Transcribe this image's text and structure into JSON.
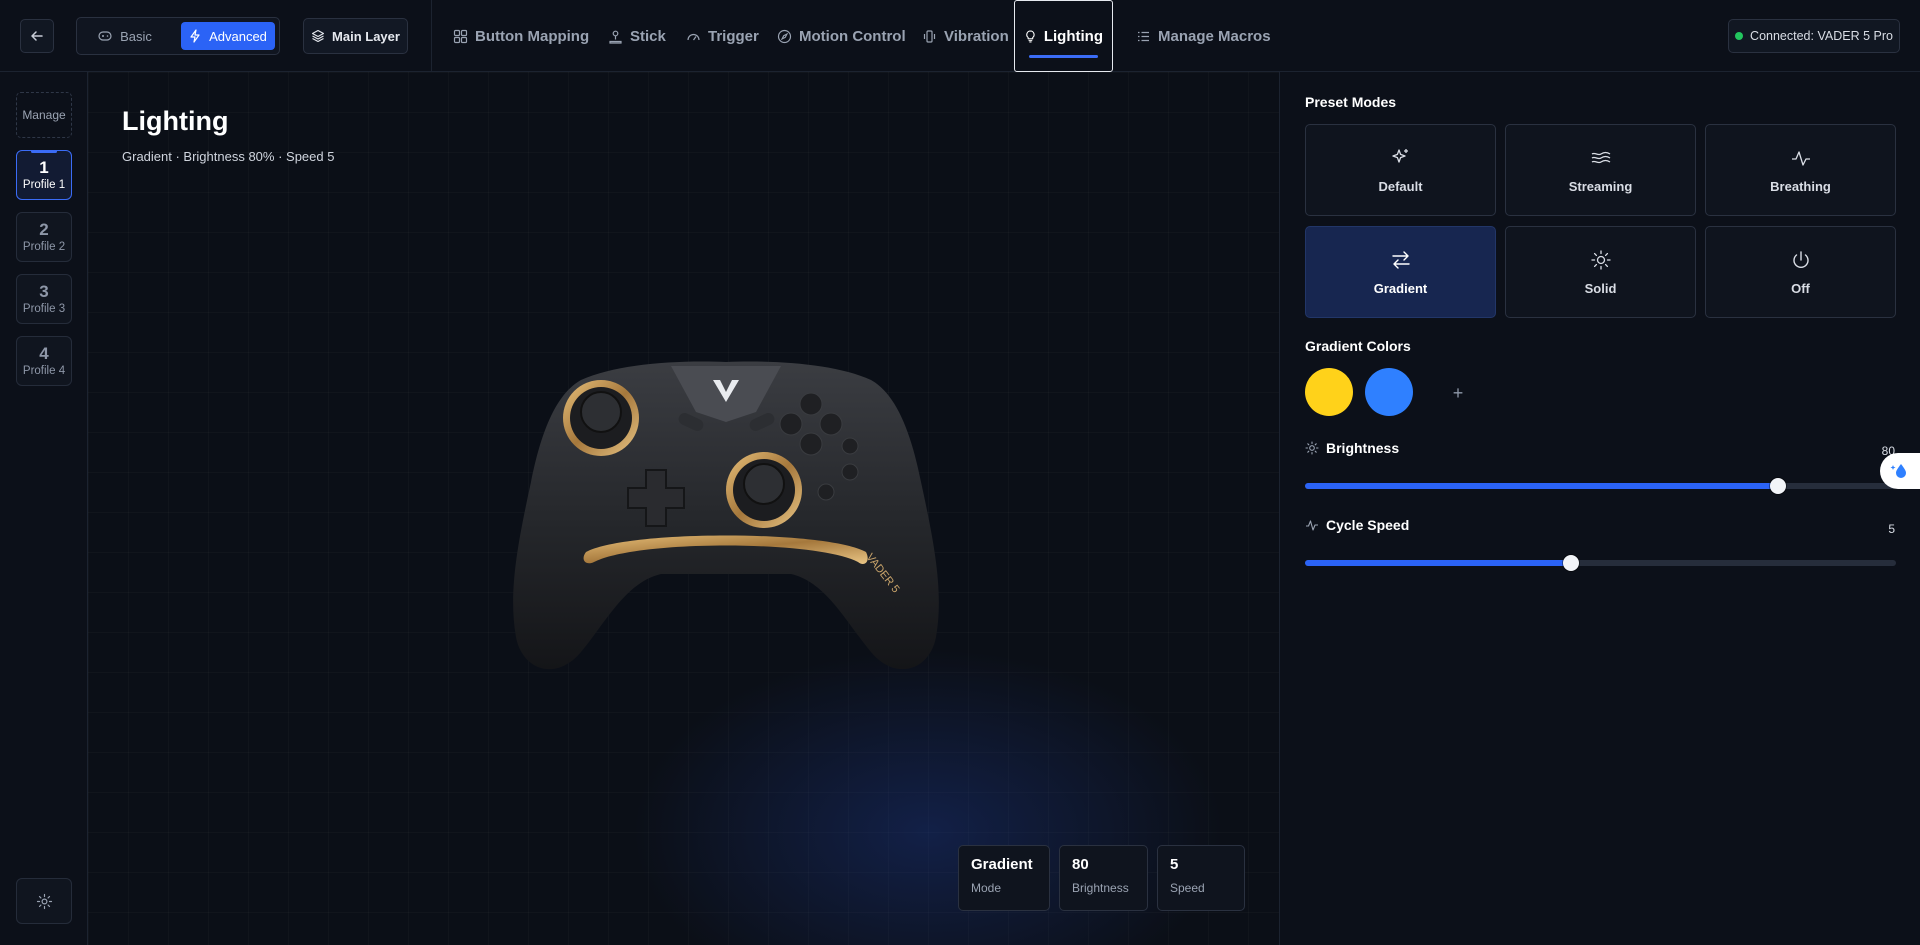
{
  "header": {
    "modes": {
      "basic": "Basic",
      "advanced": "Advanced"
    },
    "layer": "Main Layer",
    "tabs": [
      {
        "label": "Button Mapping",
        "icon": "grid-icon"
      },
      {
        "label": "Stick",
        "icon": "joystick-icon"
      },
      {
        "label": "Trigger",
        "icon": "gauge-icon"
      },
      {
        "label": "Motion Control",
        "icon": "compass-icon"
      },
      {
        "label": "Vibration",
        "icon": "vibration-icon"
      },
      {
        "label": "Lighting",
        "icon": "lightbulb-icon",
        "active": true
      },
      {
        "label": "Manage Macros",
        "icon": "list-icon"
      }
    ],
    "connection": "Connected: VADER 5 Pro",
    "connection_color": "#22c55e"
  },
  "sidebar": {
    "manage": "Manage",
    "profiles": [
      {
        "num": "1",
        "label": "Profile 1",
        "active": true
      },
      {
        "num": "2",
        "label": "Profile 2"
      },
      {
        "num": "3",
        "label": "Profile 3"
      },
      {
        "num": "4",
        "label": "Profile 4"
      }
    ]
  },
  "stage": {
    "title": "Lighting",
    "subtitle": "Gradient · Brightness 80% · Speed 5",
    "device_text": "VADER 5",
    "stats": [
      {
        "value": "Gradient",
        "label": "Mode"
      },
      {
        "value": "80",
        "label": "Brightness"
      },
      {
        "value": "5",
        "label": "Speed"
      }
    ]
  },
  "panel": {
    "preset_title": "Preset Modes",
    "presets": [
      {
        "label": "Default",
        "icon": "sparkles-icon"
      },
      {
        "label": "Streaming",
        "icon": "waves-icon"
      },
      {
        "label": "Breathing",
        "icon": "pulse-icon"
      },
      {
        "label": "Gradient",
        "icon": "arrows-swap-icon",
        "active": true
      },
      {
        "label": "Solid",
        "icon": "sun-icon"
      },
      {
        "label": "Off",
        "icon": "power-icon"
      }
    ],
    "gradient_title": "Gradient Colors",
    "gradient_colors": [
      "#ffd21a",
      "#2f80ff"
    ],
    "add_color": "+",
    "brightness": {
      "label": "Brightness",
      "value": "80",
      "fraction": 0.8
    },
    "speed": {
      "label": "Cycle Speed",
      "value": "5",
      "fraction": 0.45
    }
  },
  "colors": {
    "accent": "#2b63f6",
    "background": "#0b0f17"
  }
}
